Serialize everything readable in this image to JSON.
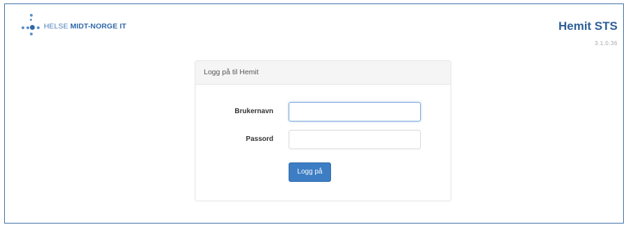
{
  "header": {
    "logo": {
      "text_regular": "HELSE",
      "text_bold": "MIDT-NORGE IT",
      "icon": "cross-dots-logo-icon"
    },
    "brand_title": "Hemit STS",
    "version": "3.1.0.36"
  },
  "login": {
    "heading": "Logg på til Hemit",
    "username_label": "Brukernavn",
    "username_value": "",
    "password_label": "Passord",
    "password_value": "",
    "submit_label": "Logg på"
  },
  "colors": {
    "frame_border": "#3e6fa7",
    "brand": "#2d5f96",
    "button": "#3c7dc4",
    "logo_dots": "#5b8fc8"
  }
}
